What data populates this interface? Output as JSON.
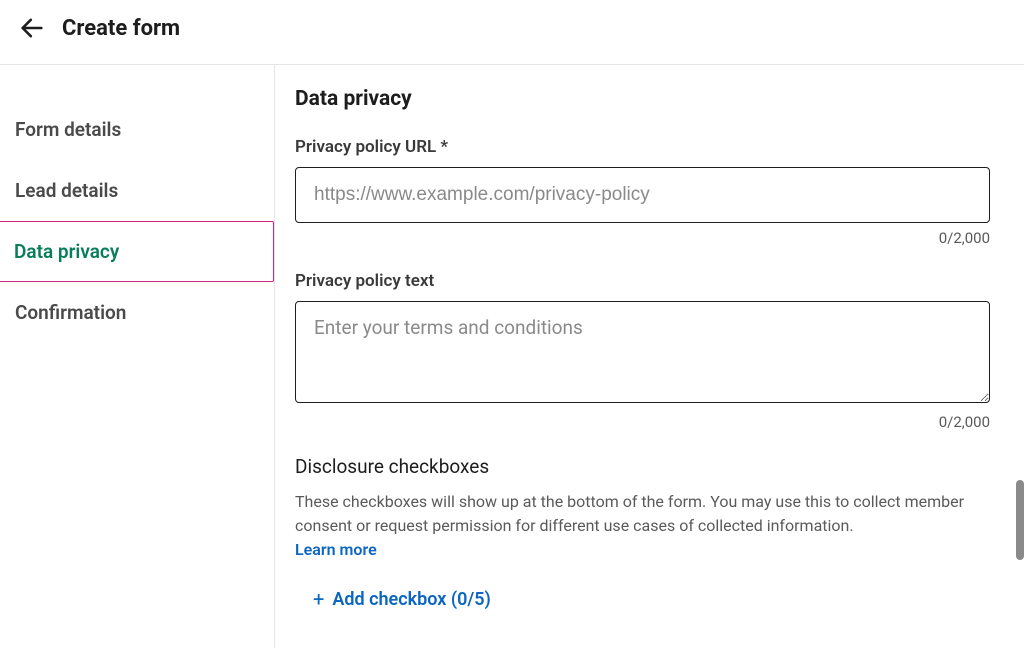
{
  "header": {
    "title": "Create form"
  },
  "sidebar": {
    "items": [
      {
        "label": "Form details",
        "active": false
      },
      {
        "label": "Lead details",
        "active": false
      },
      {
        "label": "Data privacy",
        "active": true
      },
      {
        "label": "Confirmation",
        "active": false
      }
    ]
  },
  "main": {
    "section_title": "Data privacy",
    "url_field": {
      "label": "Privacy policy URL *",
      "placeholder": "https://www.example.com/privacy-policy",
      "value": "",
      "counter": "0/2,000"
    },
    "text_field": {
      "label": "Privacy policy text",
      "placeholder": "Enter your terms and conditions",
      "value": "",
      "counter": "0/2,000"
    },
    "disclosure": {
      "title": "Disclosure checkboxes",
      "helper": "These checkboxes will show up at the bottom of the form. You may use this to collect member consent or request permission for different use cases of collected information.",
      "learn_more": "Learn more",
      "add_button": "Add checkbox (0/5)"
    }
  }
}
